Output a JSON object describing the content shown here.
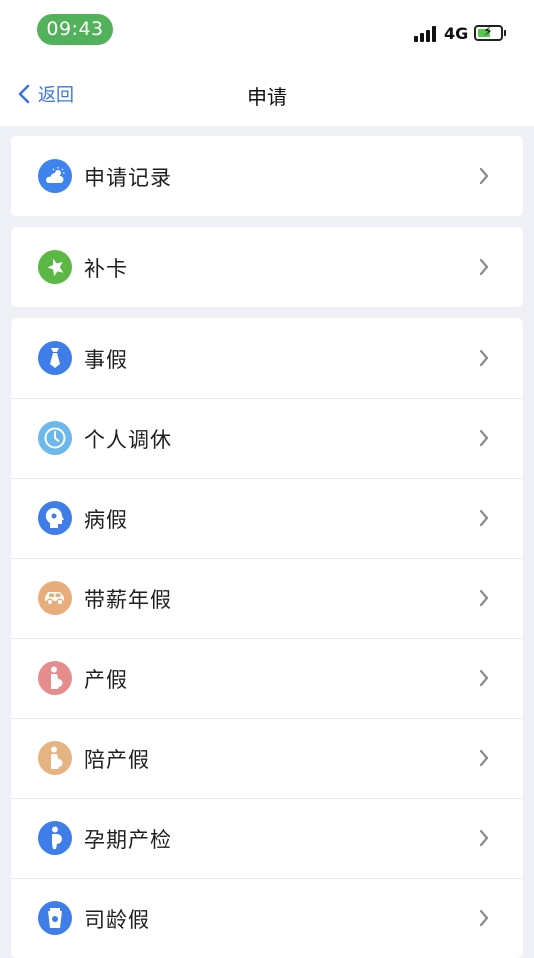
{
  "status_bar": {
    "time": "09:43",
    "network": "4G",
    "icons": [
      "signal-icon",
      "battery-charging-icon"
    ]
  },
  "nav": {
    "back_label": "返回",
    "title": "申请"
  },
  "colors": {
    "accent": "#3d74e0",
    "time_pill": "#52b25c",
    "background": "#eef0f6"
  },
  "groups": [
    {
      "items": [
        {
          "label": "申请记录",
          "icon": "weather-cloud-icon",
          "color": "#3f83ee"
        }
      ]
    },
    {
      "items": [
        {
          "label": "补卡",
          "icon": "star-hand-icon",
          "color": "#5db745"
        }
      ]
    },
    {
      "items": [
        {
          "label": "事假",
          "icon": "necktie-icon",
          "color": "#3f7de8"
        },
        {
          "label": "个人调休",
          "icon": "clock-icon",
          "color": "#6cb8ea"
        },
        {
          "label": "病假",
          "icon": "head-profile-icon",
          "color": "#3f7de8"
        },
        {
          "label": "带薪年假",
          "icon": "car-icon",
          "color": "#e9ad7c"
        },
        {
          "label": "产假",
          "icon": "pregnant-woman-icon",
          "color": "#e58c8c"
        },
        {
          "label": "陪产假",
          "icon": "pregnant-woman-icon",
          "color": "#e6b383"
        },
        {
          "label": "孕期产检",
          "icon": "pregnancy-check-icon",
          "color": "#3f7de8"
        },
        {
          "label": "司龄假",
          "icon": "cup-icon",
          "color": "#3f7de8"
        }
      ]
    }
  ]
}
